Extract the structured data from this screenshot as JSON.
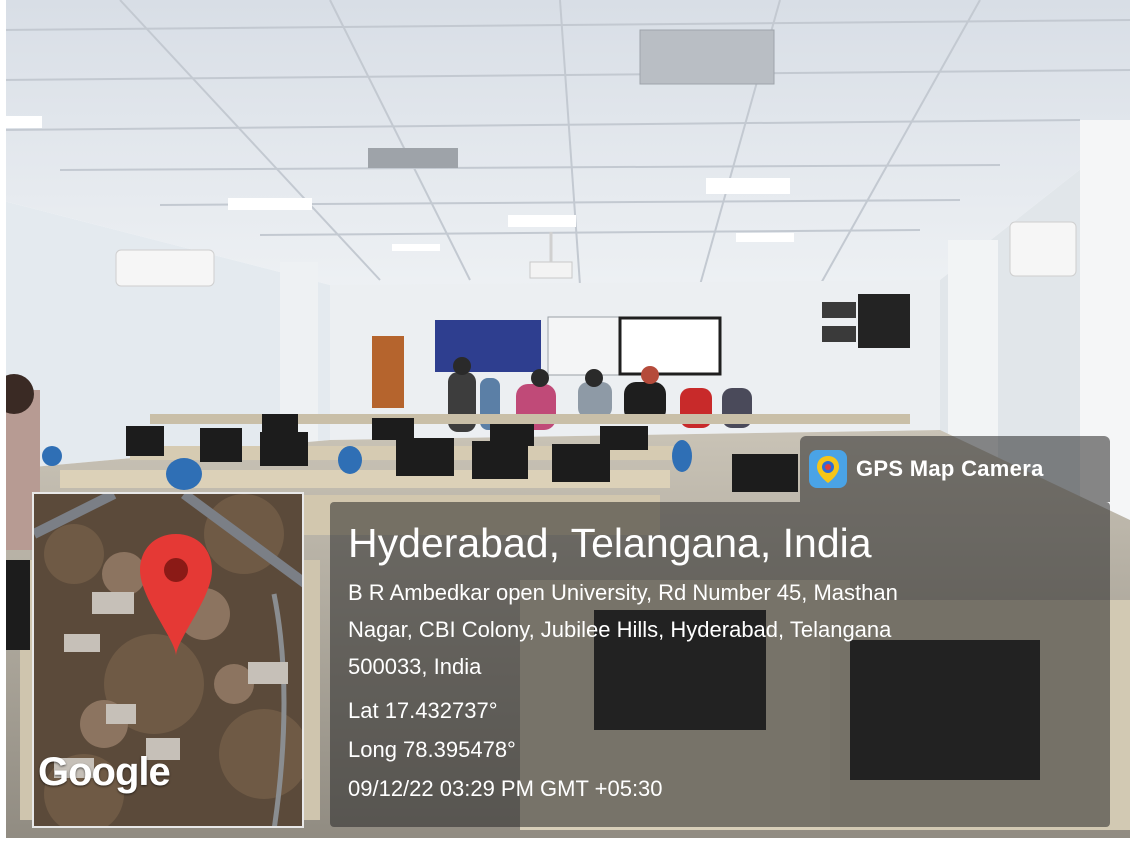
{
  "badge": {
    "label": "GPS Map Camera",
    "icon": "gps-map-camera-app-icon"
  },
  "location": {
    "title": "Hyderabad, Telangana, India",
    "address_line_1": "B R Ambedkar open University, Rd Number 45, Masthan",
    "address_line_2": "Nagar, CBI Colony, Jubilee Hills, Hyderabad, Telangana",
    "address_line_3": "500033, India",
    "lat": "Lat 17.432737°",
    "long": "Long 78.395478°",
    "datetime": "09/12/22 03:29 PM GMT +05:30"
  },
  "map": {
    "watermark": "Google",
    "pin_color": "#e53935"
  },
  "colors": {
    "ceiling": "#dfe5ec",
    "wall": "#e9eef2",
    "desk": "#d9cdb4",
    "chair": "#2f6fb5",
    "overlay": "#282828"
  }
}
